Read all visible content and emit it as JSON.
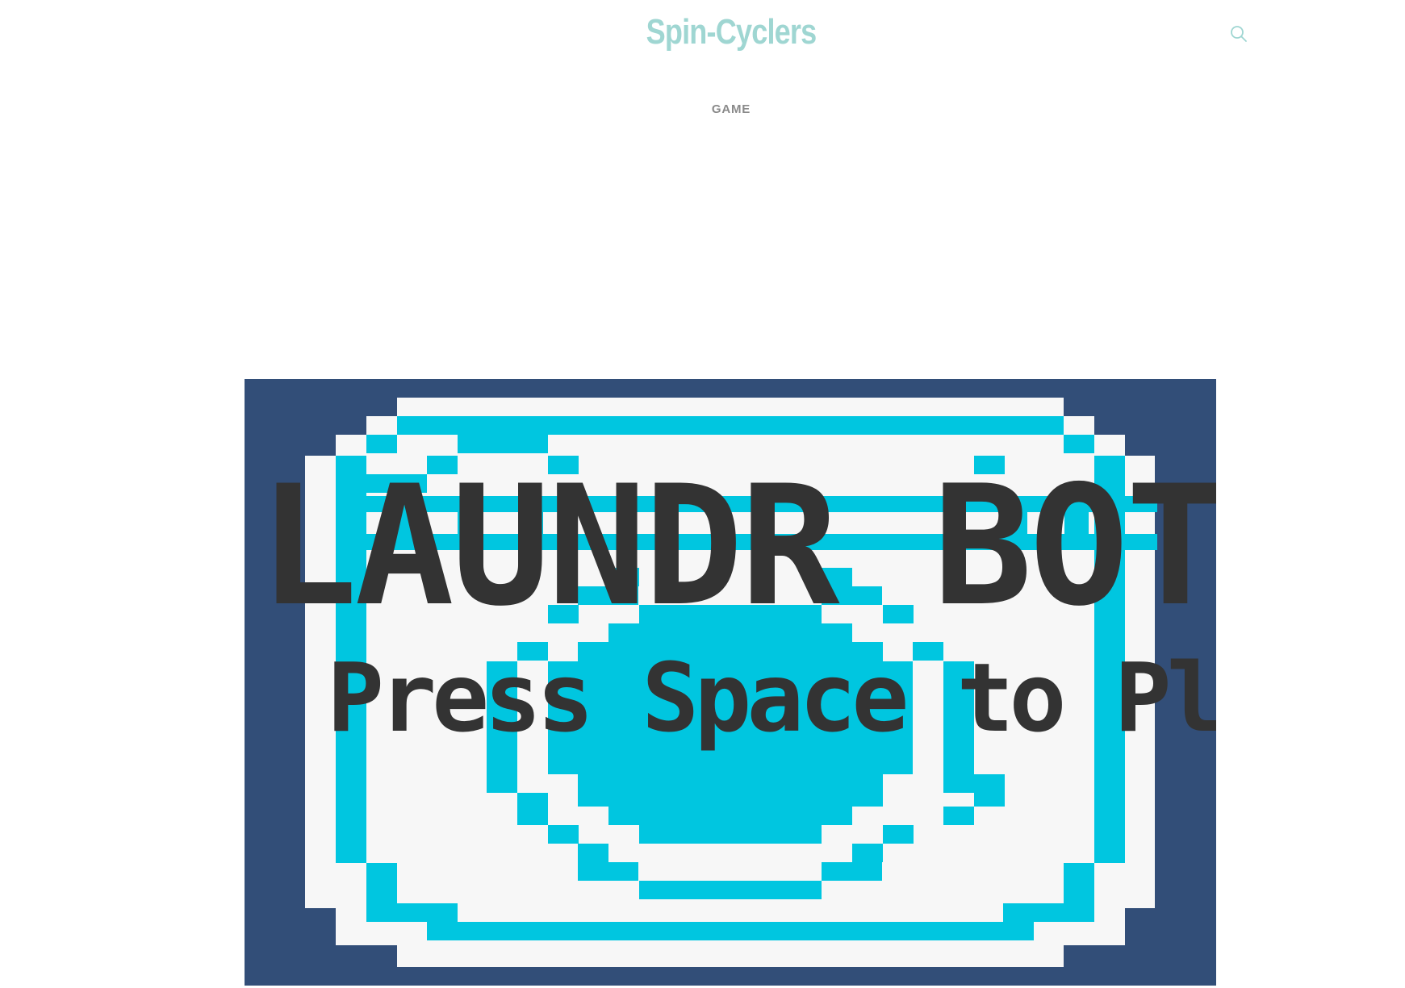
{
  "header": {
    "site_title": "Spin-Cyclers",
    "search_icon": "search-icon",
    "accent_color": "#9fd6d2"
  },
  "nav": {
    "items": [
      {
        "label": "GAME"
      }
    ]
  },
  "game": {
    "title": "LAUNDR BOT",
    "prompt": "Press Space to Play",
    "colors": {
      "background": "#324e78",
      "frame_white": "#f7f7f7",
      "cyan": "#00c6e0",
      "text": "#333333"
    }
  }
}
